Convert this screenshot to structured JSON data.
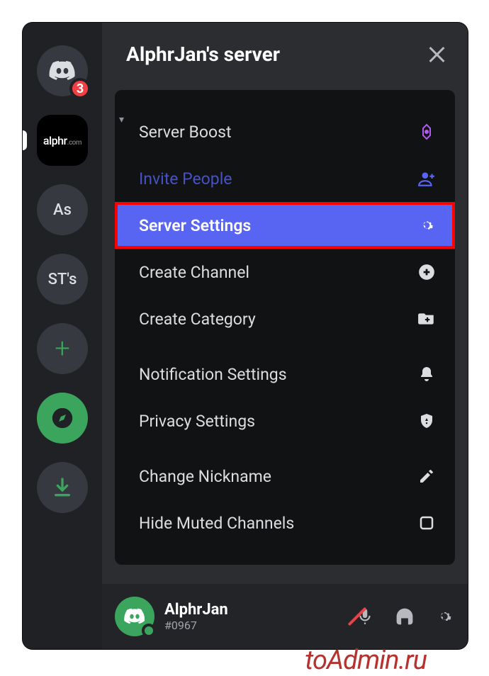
{
  "header": {
    "title": "AlphrJan's server"
  },
  "serverbar": {
    "home_badge": "3",
    "items": [
      {
        "label": "alphr",
        "domain": ".com"
      },
      {
        "label": "As"
      },
      {
        "label": "ST's"
      }
    ]
  },
  "menu": {
    "rows": [
      {
        "key": "boost",
        "label": "Server Boost",
        "icon": "boost-gem-icon"
      },
      {
        "key": "invite",
        "label": "Invite People",
        "icon": "add-person-icon"
      },
      {
        "key": "settings",
        "label": "Server Settings",
        "icon": "gear-icon",
        "highlighted": true
      },
      {
        "key": "create-channel",
        "label": "Create Channel",
        "icon": "plus-circle-icon"
      },
      {
        "key": "create-category",
        "label": "Create Category",
        "icon": "folder-plus-icon"
      },
      {
        "key": "notifications",
        "label": "Notification Settings",
        "icon": "bell-icon"
      },
      {
        "key": "privacy",
        "label": "Privacy Settings",
        "icon": "shield-icon"
      },
      {
        "key": "nickname",
        "label": "Change Nickname",
        "icon": "pencil-icon"
      },
      {
        "key": "hide-muted",
        "label": "Hide Muted Channels",
        "icon": "checkbox-empty-icon"
      }
    ]
  },
  "user": {
    "name": "AlphrJan",
    "tag": "#0967"
  },
  "watermark": "toAdmin.ru"
}
